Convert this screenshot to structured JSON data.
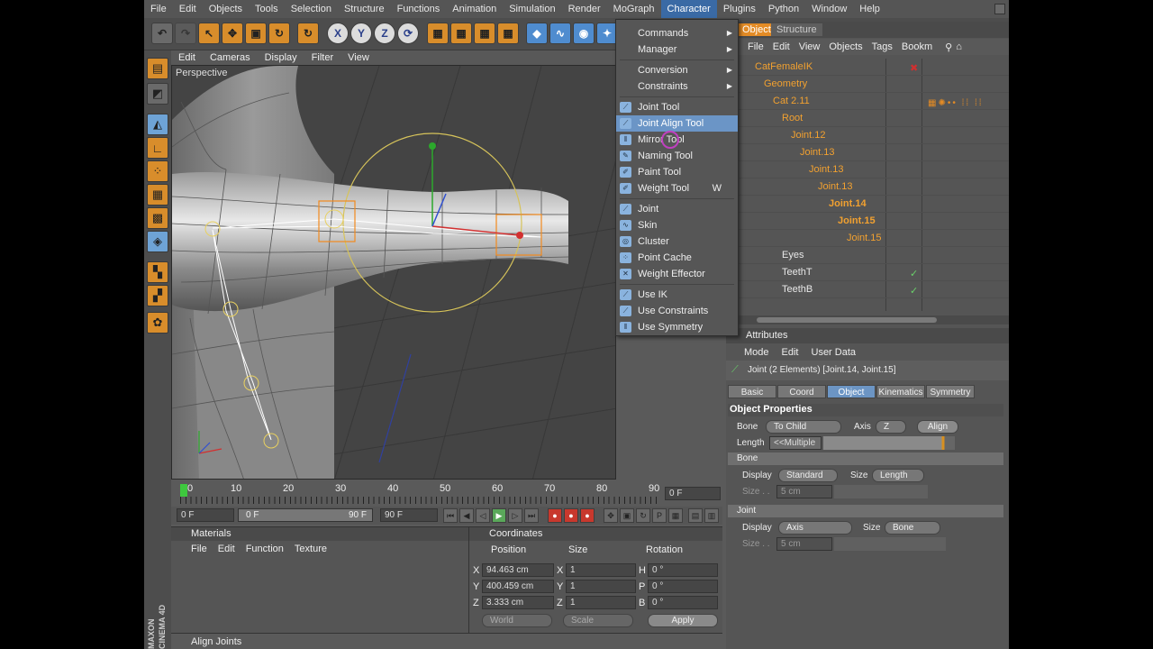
{
  "menubar": [
    "File",
    "Edit",
    "Objects",
    "Tools",
    "Selection",
    "Structure",
    "Functions",
    "Animation",
    "Simulation",
    "Render",
    "MoGraph",
    "Character",
    "Plugins",
    "Python",
    "Window",
    "Help"
  ],
  "viewport": {
    "menu": [
      "Edit",
      "Cameras",
      "Display",
      "Filter",
      "View"
    ],
    "label": "Perspective"
  },
  "timeline": {
    "ticks": [
      "0",
      "10",
      "20",
      "30",
      "40",
      "50",
      "60",
      "70",
      "80",
      "90"
    ],
    "current_frame": "0 F",
    "start": "0 F",
    "range_start": "0 F",
    "range_end": "90 F",
    "end": "90 F"
  },
  "materials": {
    "title": "Materials",
    "menu": [
      "File",
      "Edit",
      "Function",
      "Texture"
    ]
  },
  "coordinates": {
    "title": "Coordinates",
    "cols": [
      "Position",
      "Size",
      "Rotation"
    ],
    "rows": [
      {
        "axis": "X",
        "pos": "94.463 cm",
        "saxis": "X",
        "size": "1",
        "raxis": "H",
        "rot": "0 °"
      },
      {
        "axis": "Y",
        "pos": "400.459 cm",
        "saxis": "Y",
        "size": "1",
        "raxis": "P",
        "rot": "0 °"
      },
      {
        "axis": "Z",
        "pos": "3.333 cm",
        "saxis": "Z",
        "size": "1",
        "raxis": "B",
        "rot": "0 °"
      }
    ],
    "mode": "World",
    "size_mode": "Scale",
    "apply": "Apply"
  },
  "status": "Align Joints",
  "logo": "MAXON CINEMA 4D",
  "object_manager": {
    "tabs": [
      "Objects",
      "Structure"
    ],
    "menu": [
      "File",
      "Edit",
      "View",
      "Objects",
      "Tags",
      "Bookm"
    ],
    "items": [
      {
        "name": "CatFemaleIK"
      },
      {
        "name": "Geometry"
      },
      {
        "name": "Cat 2.11"
      },
      {
        "name": "Root"
      },
      {
        "name": "Joint.12"
      },
      {
        "name": "Joint.13"
      },
      {
        "name": "Joint.13"
      },
      {
        "name": "Joint.13"
      },
      {
        "name": "Joint.14"
      },
      {
        "name": "Joint.15"
      },
      {
        "name": "Joint.15"
      },
      {
        "name": "Eyes"
      },
      {
        "name": "TeethT"
      },
      {
        "name": "TeethB"
      }
    ]
  },
  "attributes": {
    "title": "Attributes",
    "menu": [
      "Mode",
      "Edit",
      "User Data"
    ],
    "selection": "Joint (2 Elements) [Joint.14, Joint.15]",
    "tabs": [
      "Basic",
      "Coord",
      "Object",
      "Kinematics",
      "Symmetry"
    ],
    "section": "Object Properties",
    "bone_label": "Bone",
    "bone_value": "To Child",
    "axis_label": "Axis",
    "axis_value": "Z",
    "align": "Align",
    "length_label": "Length",
    "length_value": "<<Multiple",
    "bone_section": "Bone",
    "display_label": "Display",
    "bone_display": "Standard",
    "size_label": "Size",
    "bone_size": "Length",
    "size2_label": "Size . .",
    "bone_size_val": "5 cm",
    "joint_section": "Joint",
    "joint_display": "Axis",
    "joint_size": "Bone",
    "joint_size_val": "5 cm"
  },
  "character_menu": {
    "items": [
      {
        "label": "Commands",
        "submenu": true
      },
      {
        "label": "Manager",
        "submenu": true
      },
      {
        "label": "Conversion",
        "submenu": true
      },
      {
        "label": "Constraints",
        "submenu": true
      },
      {
        "label": "Joint Tool"
      },
      {
        "label": "Joint Align Tool"
      },
      {
        "label": "Mirror Tool"
      },
      {
        "label": "Naming Tool"
      },
      {
        "label": "Paint Tool"
      },
      {
        "label": "Weight Tool",
        "shortcut": "W"
      },
      {
        "label": "Joint"
      },
      {
        "label": "Skin"
      },
      {
        "label": "Cluster"
      },
      {
        "label": "Point Cache"
      },
      {
        "label": "Weight Effector"
      },
      {
        "label": "Use IK"
      },
      {
        "label": "Use Constraints"
      },
      {
        "label": "Use Symmetry"
      }
    ]
  },
  "colors": {
    "accent": "#3a6aa5",
    "highlight": "#6b95c6",
    "object_name": "#f2a130"
  }
}
